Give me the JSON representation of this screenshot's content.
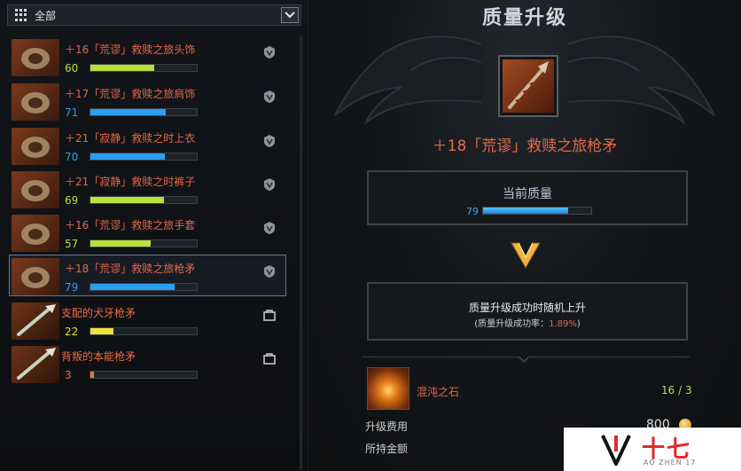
{
  "filter": {
    "label": "全部"
  },
  "items": [
    {
      "name": "＋16「荒谬」救赎之旅头饰",
      "quality": "60",
      "q": 60,
      "color": "#b8e23a"
    },
    {
      "name": "＋17「荒谬」救赎之旅肩饰",
      "quality": "71",
      "q": 71,
      "color": "#2b9ef0"
    },
    {
      "name": "＋21「寂静」救赎之时上衣",
      "quality": "70",
      "q": 70,
      "color": "#2b9ef0"
    },
    {
      "name": "＋21「寂静」救赎之时裤子",
      "quality": "69",
      "q": 69,
      "color": "#b8e23a"
    },
    {
      "name": "＋16「荒谬」救赎之旅手套",
      "quality": "57",
      "q": 57,
      "color": "#b8e23a"
    },
    {
      "name": "＋18「荒谬」救赎之旅枪矛",
      "quality": "79",
      "q": 79,
      "color": "#2b9ef0"
    },
    {
      "name": "支配的犬牙枪矛",
      "quality": "22",
      "q": 22,
      "color": "#f0e03a"
    },
    {
      "name": "背叛的本能枪矛",
      "quality": "3",
      "q": 3,
      "color": "#e0783a"
    }
  ],
  "panel": {
    "title": "质量升级",
    "item_name": "＋18「荒谬」救赎之旅枪矛",
    "current_quality_label": "当前质量",
    "current_quality_value": "79",
    "current_quality": 79,
    "result_text": "质量升级成功时随机上升",
    "rate_label": "(质量升级成功率：",
    "rate_value": "1.89%",
    "rate_close": ")",
    "material_name": "混沌之石",
    "material_count": "16 / 3",
    "fee_label": "升级费用",
    "fee_value": "800",
    "held_label": "所持金额"
  },
  "watermark": {
    "text": "十七",
    "sub": "AO ZHEN 17"
  },
  "colors": {
    "accent_red": "#e36a47",
    "quality_blue": "#2b9ef0",
    "quality_green": "#b8e23a",
    "count_green": "#b8dc60"
  }
}
